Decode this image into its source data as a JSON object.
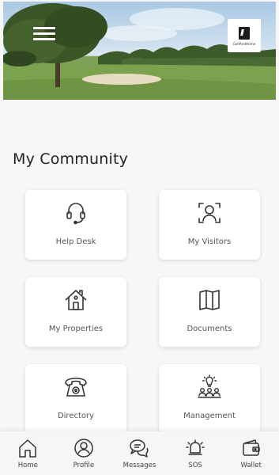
{
  "header": {
    "logo_text": "GolfAndHome",
    "menu_icon": "hamburger-menu-icon"
  },
  "section": {
    "title": "My Community"
  },
  "tiles": [
    {
      "label": "Help Desk",
      "icon": "headset-icon"
    },
    {
      "label": "My Visitors",
      "icon": "visitor-scan-icon"
    },
    {
      "label": "My Properties",
      "icon": "house-icon"
    },
    {
      "label": "Documents",
      "icon": "open-book-icon"
    },
    {
      "label": "Directory",
      "icon": "telephone-icon"
    },
    {
      "label": "Management",
      "icon": "management-team-icon"
    }
  ],
  "nav": [
    {
      "label": "Home",
      "icon": "home-icon"
    },
    {
      "label": "Profile",
      "icon": "profile-icon"
    },
    {
      "label": "Messages",
      "icon": "messages-icon"
    },
    {
      "label": "SOS",
      "icon": "sos-bell-icon"
    },
    {
      "label": "Wallet",
      "icon": "wallet-icon"
    }
  ],
  "colors": {
    "background": "#f7f7f7",
    "tile": "#ffffff",
    "icon_stroke": "#333333",
    "text": "#222222"
  }
}
